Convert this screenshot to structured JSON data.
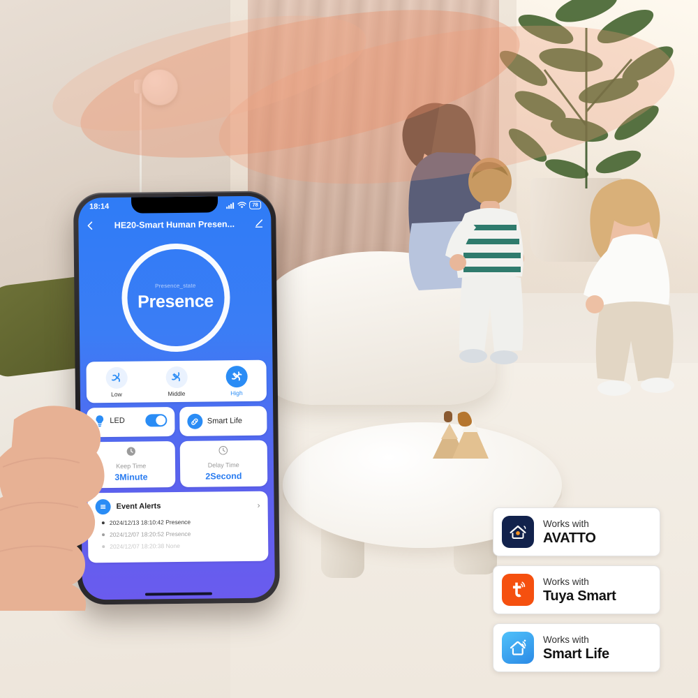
{
  "scene": {
    "description": "living-room-with-family",
    "device": "round-white-wall-presence-sensor",
    "wave_color": "#f0a07e"
  },
  "phone": {
    "statusbar": {
      "time": "18:14",
      "signal_icon": "cellular-signal-icon",
      "wifi_icon": "wifi-icon",
      "battery_level": "78"
    },
    "navbar": {
      "back_icon": "chevron-left-icon",
      "title": "HE20-Smart Human Presen...",
      "edit_icon": "pencil-edit-icon"
    },
    "hero": {
      "state_label": "Presence_state",
      "state_value": "Presence"
    },
    "sensitivity": {
      "options": [
        {
          "label": "Low",
          "icon": "fan-swirl-icon",
          "selected": false
        },
        {
          "label": "Middle",
          "icon": "fan-swirl-icon",
          "selected": false
        },
        {
          "label": "High",
          "icon": "fan-swirl-icon",
          "selected": true
        }
      ]
    },
    "led": {
      "icon": "lightbulb-icon",
      "label": "LED",
      "toggle_state": "on"
    },
    "smart_life": {
      "icon": "link-icon",
      "label": "Smart Life"
    },
    "keep_time": {
      "icon": "clock-filled-icon",
      "label": "Keep Time",
      "value": "3Minute"
    },
    "delay_time": {
      "icon": "clock-outline-icon",
      "label": "Delay Time",
      "value": "2Second"
    },
    "events": {
      "icon": "list-menu-icon",
      "title": "Event Alerts",
      "chevron_icon": "chevron-right-icon",
      "items": [
        {
          "text": "2024/12/13 18:10:42 Presence",
          "opacity": 1
        },
        {
          "text": "2024/12/07 18:20:52 Presence",
          "opacity": 0.55
        },
        {
          "text": "2024/12/07 18:20:38 None",
          "opacity": 0.28
        }
      ]
    },
    "accent_color": "#2a8cf5"
  },
  "badges": [
    {
      "prefix": "Works with",
      "name": "AVATTO",
      "logo_icon": "avatto-house-logo-icon",
      "logo_bg": "#12224c",
      "logo_accent": "#f59324"
    },
    {
      "prefix": "Works with",
      "name": "Tuya Smart",
      "logo_icon": "tuya-t-logo-icon",
      "logo_bg": "#f5500f",
      "logo_accent": "#ffffff"
    },
    {
      "prefix": "Works with",
      "name": "Smart Life",
      "logo_icon": "smartlife-house-wifi-logo-icon",
      "logo_bg": "#38a5f0",
      "logo_accent": "#ffffff"
    }
  ]
}
